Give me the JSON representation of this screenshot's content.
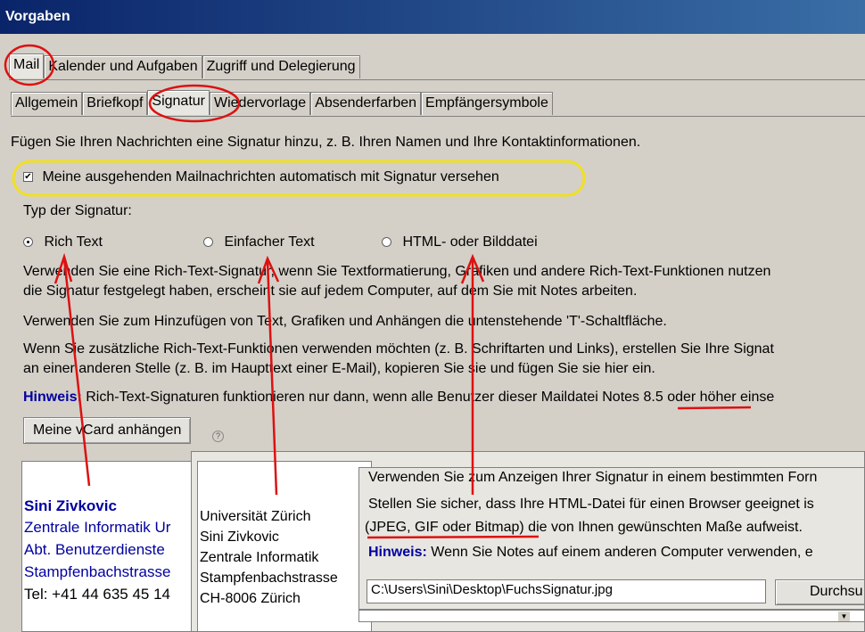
{
  "window": {
    "title": "Vorgaben"
  },
  "tabs_top": [
    "Mail",
    "Kalender und Aufgaben",
    "Zugriff und Delegierung"
  ],
  "tabs_sub": [
    "Allgemein",
    "Briefkopf",
    "Signatur",
    "Wiedervorlage",
    "Absenderfarben",
    "Empfängersymbole"
  ],
  "intro": "Fügen Sie Ihren Nachrichten eine Signatur hinzu, z. B. Ihren Namen und Ihre Kontaktinformationen.",
  "auto_sign": {
    "label": "Meine ausgehenden Mailnachrichten automatisch mit Signatur versehen",
    "checked": true
  },
  "sig_type": {
    "label": "Typ der Signatur:",
    "options": [
      "Rich Text",
      "Einfacher Text",
      "HTML- oder Bilddatei"
    ],
    "selected": "Rich Text"
  },
  "desc": {
    "line1": "Verwenden Sie eine Rich-Text-Signatur, wenn Sie Textformatierung, Grafiken und andere Rich-Text-Funktionen nutzen",
    "line2": "die Signatur festgelegt haben, erscheint sie auf jedem Computer, auf dem Sie mit Notes arbeiten.",
    "line3": "Verwenden Sie zum Hinzufügen von Text, Grafiken und Anhängen die untenstehende 'T'-Schaltfläche.",
    "line4": "Wenn Sie zusätzliche Rich-Text-Funktionen verwenden möchten (z. B. Schriftarten und Links), erstellen Sie Ihre Signat",
    "line5": "an einer anderen Stelle (z. B. im Haupttext einer E-Mail), kopieren Sie sie und fügen Sie sie hier ein."
  },
  "hint": {
    "label": "Hinweis:",
    "text": "Rich-Text-Signaturen funktionieren nur dann, wenn alle Benutzer dieser Maildatei",
    "version": "Notes 8.5",
    "text_after": "oder höher einse"
  },
  "vcard_button": "Meine vCard anhängen",
  "help_icon": "?",
  "rich_sig": {
    "name": "Sini Zivkovic",
    "line2": "Zentrale Informatik Ur",
    "line3": "Abt. Benutzerdienste",
    "line4": "Stampfenbachstrasse",
    "line5": "Tel: +41 44 635 45 14"
  },
  "plain_sig": [
    "Universität Zürich",
    "Sini Zivkovic",
    "Zentrale Informatik",
    "Stampfenbachstrasse",
    "CH-8006 Zürich"
  ],
  "html_panel": {
    "line1": "Verwenden Sie zum Anzeigen Ihrer Signatur in einem bestimmten Forn",
    "line2": "Stellen Sie sicher, dass Ihre HTML-Datei für einen Browser geeignet is",
    "line3_a": "(JPEG, GIF oder Bitmap)",
    "line3_b": "die von Ihnen gewünschten Maße aufweist.",
    "hint_label": "Hinweis:",
    "hint_text": "Wenn Sie Notes auf einem anderen Computer verwenden, e",
    "path": "C:\\Users\\Sini\\Desktop\\FuchsSignatur.jpg",
    "browse_button": "Durchsu"
  },
  "colors": {
    "annotation_red": "#dd1111",
    "annotation_yellow": "#f0e020",
    "hint_blue": "#0000a0",
    "title_bar": "#0a246a"
  }
}
